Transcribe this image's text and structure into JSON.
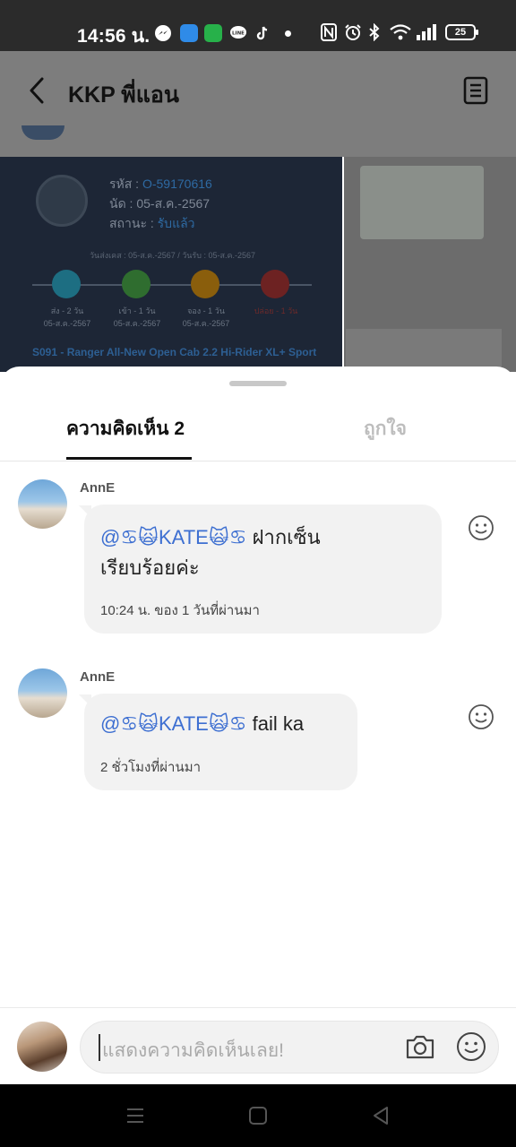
{
  "status_bar": {
    "time": "14:56 น.",
    "battery": "25",
    "app_icons": [
      "messenger-icon",
      "blue-app-icon",
      "green-app-icon",
      "line-icon",
      "tiktok-icon"
    ],
    "system_icons": [
      "nfc-icon",
      "alarm-icon",
      "bluetooth-icon",
      "wifi-icon",
      "signal-icon"
    ]
  },
  "header": {
    "title": "KKP พี่แอน"
  },
  "post_card": {
    "code_label": "รหัส : ",
    "code_value": "O-59170616",
    "date_label": "นัด : 05-ส.ค.-2567",
    "status_label": "สถานะ : ",
    "status_value": "รับแล้ว",
    "dates_line": "วันส่งเคส : 05-ส.ค.-2567 / วันรับ : 05-ส.ค.-2567",
    "steps": [
      {
        "label": "ส่ง - 2 วัน",
        "date": "05-ส.ค.-2567",
        "color": "#1d8ea8"
      },
      {
        "label": "เข้า - 1 วัน",
        "date": "05-ส.ค.-2567",
        "color": "#3a8a3a"
      },
      {
        "label": "จอง - 1 วัน",
        "date": "05-ส.ค.-2567",
        "color": "#b57a0f"
      },
      {
        "label": "ปล่อย - 1 วัน",
        "date": "",
        "color": "#8a2a2a"
      }
    ],
    "car_model": "S091 - Ranger All-New Open Cab 2.2 Hi-Rider XL+ Sport"
  },
  "sheet": {
    "tabs": [
      {
        "label": "ความคิดเห็น 2",
        "active": true
      },
      {
        "label": "ถูกใจ",
        "active": false
      }
    ]
  },
  "comments": [
    {
      "author": "AnnE",
      "mention": "@♋🙀KATE🙀♋",
      "text_line1": " ฝากเซ็น",
      "text_line2": "เรียบร้อยค่ะ",
      "time": "10:24 น. ของ 1 วันที่ผ่านมา"
    },
    {
      "author": "AnnE",
      "mention": "@♋🙀KATE🙀♋",
      "text_line1": " fail ka",
      "text_line2": "",
      "time": "2 ชั่วโมงที่ผ่านมา"
    }
  ],
  "input": {
    "placeholder": "แสดงความคิดเห็นเลย!"
  },
  "colors": {
    "accent_blue": "#3d6fd1",
    "bubble_bg": "#f2f2f2",
    "dim_overlay": "#7d7d7d"
  }
}
